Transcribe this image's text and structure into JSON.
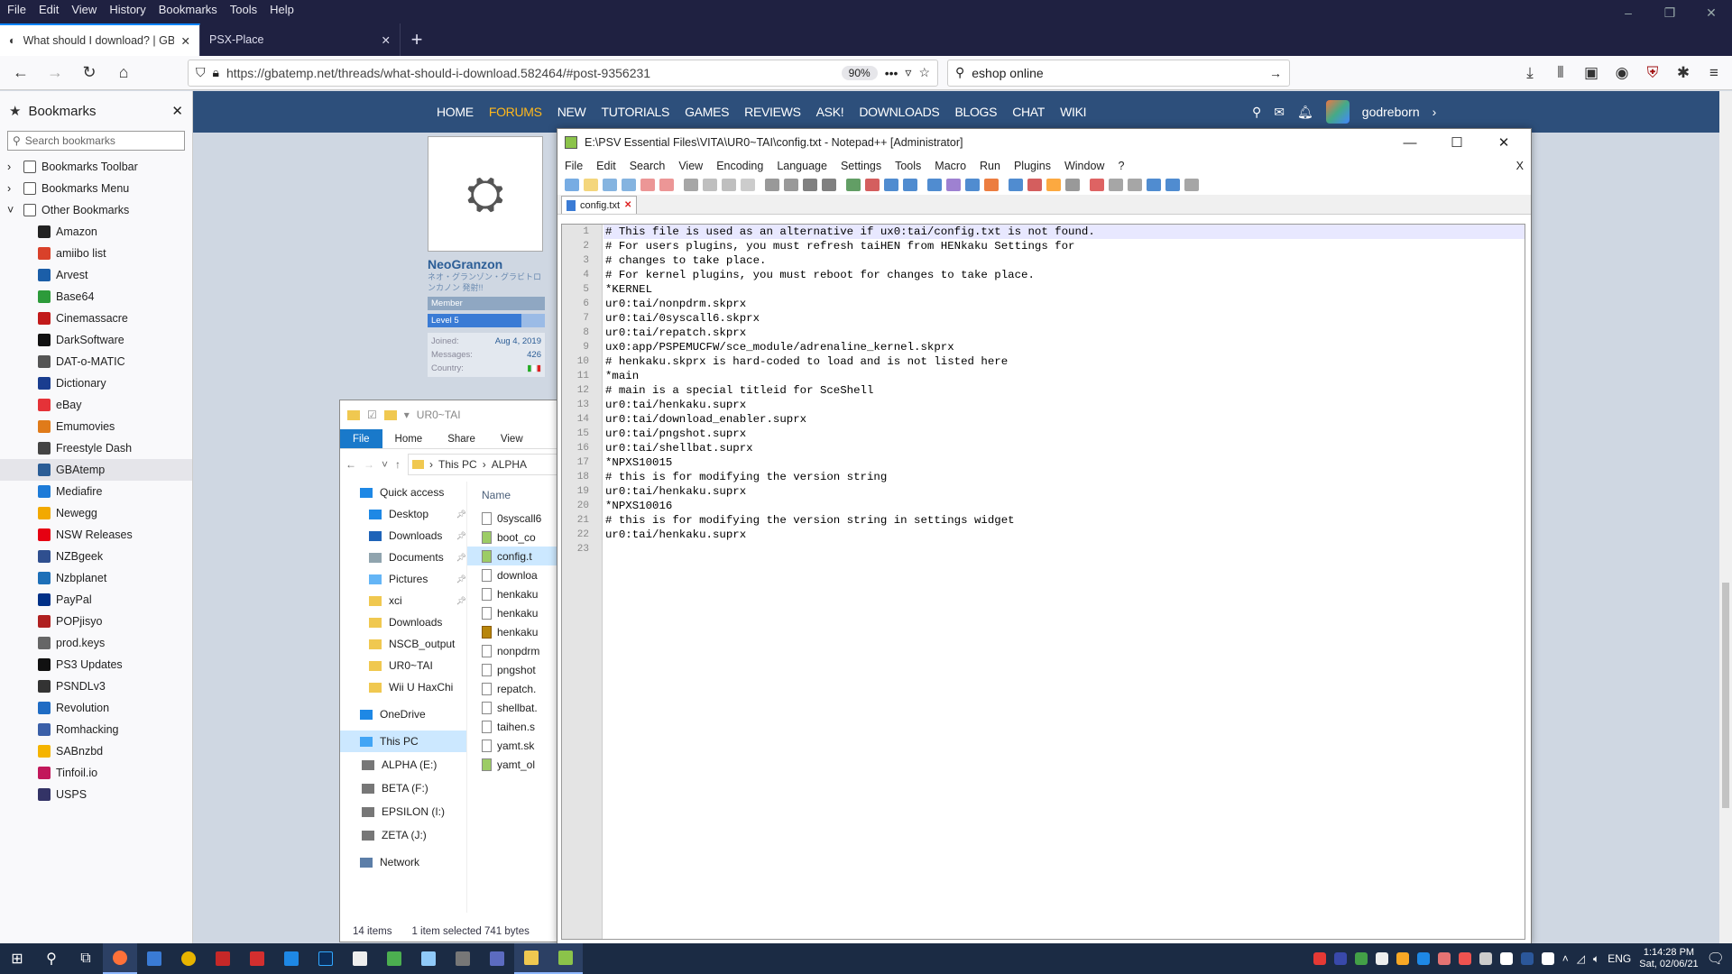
{
  "browser": {
    "menu": [
      "File",
      "Edit",
      "View",
      "History",
      "Bookmarks",
      "Tools",
      "Help"
    ],
    "tabs": [
      {
        "title": "What should I download? | GBA"
      },
      {
        "title": "PSX-Place"
      }
    ],
    "url": "https://gbatemp.net/threads/what-should-i-download.582464/#post-9356231",
    "zoom": "90%",
    "search": "eshop online"
  },
  "bookmarks": {
    "title": "Bookmarks",
    "search_placeholder": "Search bookmarks",
    "folders": [
      "Bookmarks Toolbar",
      "Bookmarks Menu",
      "Other Bookmarks"
    ],
    "items": [
      {
        "label": "Amazon",
        "color": "#222"
      },
      {
        "label": "amiibo list",
        "color": "#d9412a"
      },
      {
        "label": "Arvest",
        "color": "#1b5ea8"
      },
      {
        "label": "Base64",
        "color": "#2d9b3a"
      },
      {
        "label": "Cinemassacre",
        "color": "#c21a1a"
      },
      {
        "label": "DarkSoftware",
        "color": "#111"
      },
      {
        "label": "DAT-o-MATIC",
        "color": "#555"
      },
      {
        "label": "Dictionary",
        "color": "#1a3d8f"
      },
      {
        "label": "eBay",
        "color": "#e53238"
      },
      {
        "label": "Emumovies",
        "color": "#e07b1a"
      },
      {
        "label": "Freestyle Dash",
        "color": "#444"
      },
      {
        "label": "GBAtemp",
        "color": "#2b5d96"
      },
      {
        "label": "Mediafire",
        "color": "#1d7bd8"
      },
      {
        "label": "Newegg",
        "color": "#f2a900"
      },
      {
        "label": "NSW Releases",
        "color": "#e60012"
      },
      {
        "label": "NZBgeek",
        "color": "#2f4f8f"
      },
      {
        "label": "Nzbplanet",
        "color": "#1d6fb8"
      },
      {
        "label": "PayPal",
        "color": "#003087"
      },
      {
        "label": "POPjisyo",
        "color": "#b02020"
      },
      {
        "label": "prod.keys",
        "color": "#666"
      },
      {
        "label": "PS3 Updates",
        "color": "#111"
      },
      {
        "label": "PSNDLv3",
        "color": "#333"
      },
      {
        "label": "Revolution",
        "color": "#1f6cc4"
      },
      {
        "label": "Romhacking",
        "color": "#3a5fa8"
      },
      {
        "label": "SABnzbd",
        "color": "#f5b400"
      },
      {
        "label": "Tinfoil.io",
        "color": "#c2185b"
      },
      {
        "label": "USPS",
        "color": "#333366"
      }
    ]
  },
  "site": {
    "nav": [
      "HOME",
      "FORUMS",
      "NEW",
      "TUTORIALS",
      "GAMES",
      "REVIEWS",
      "ASK!",
      "DOWNLOADS",
      "BLOGS",
      "CHAT",
      "WIKI"
    ],
    "username": "godreborn",
    "profile": {
      "name": "NeoGranzon",
      "jp": "ネオ・グランゾン・グラビトロンカノン 発射!!",
      "badge1": "Member",
      "badge2": "Level 5",
      "joined_label": "Joined:",
      "joined": "Aug 4, 2019",
      "messages_label": "Messages:",
      "messages": "426",
      "country_label": "Country:"
    }
  },
  "explorer": {
    "title": "UR0~TAI",
    "ribbon": [
      "File",
      "Home",
      "Share",
      "View"
    ],
    "path": [
      "This PC",
      "ALPHA"
    ],
    "col_name": "Name",
    "nav": [
      {
        "label": "Quick access",
        "kind": "star"
      },
      {
        "label": "Desktop",
        "kind": "blue",
        "pin": true
      },
      {
        "label": "Downloads",
        "kind": "down",
        "pin": true
      },
      {
        "label": "Documents",
        "kind": "doc",
        "pin": true
      },
      {
        "label": "Pictures",
        "kind": "pic",
        "pin": true
      },
      {
        "label": "xci",
        "kind": "folder",
        "pin": true
      },
      {
        "label": "Downloads",
        "kind": "folder"
      },
      {
        "label": "NSCB_output",
        "kind": "folder"
      },
      {
        "label": "UR0~TAI",
        "kind": "folder"
      },
      {
        "label": "Wii U HaxChi",
        "kind": "folder"
      },
      {
        "label": "OneDrive",
        "kind": "cloud"
      },
      {
        "label": "This PC",
        "kind": "pc"
      },
      {
        "label": "ALPHA (E:)",
        "kind": "drive"
      },
      {
        "label": "BETA (F:)",
        "kind": "drive"
      },
      {
        "label": "EPSILON (I:)",
        "kind": "drive"
      },
      {
        "label": "ZETA (J:)",
        "kind": "drive"
      },
      {
        "label": "Network",
        "kind": "net"
      }
    ],
    "files": [
      "0syscall6",
      "boot_co",
      "config.t",
      "downloa",
      "henkaku",
      "henkaku",
      "henkaku",
      "nonpdrm",
      "pngshot",
      "repatch.",
      "shellbat.",
      "taihen.s",
      "yamt.sk",
      "yamt_ol"
    ],
    "status": [
      "14 items",
      "1 item selected  741 bytes"
    ]
  },
  "notepad": {
    "title": "E:\\PSV Essential Files\\VITA\\UR0~TAI\\config.txt - Notepad++ [Administrator]",
    "menu": [
      "File",
      "Edit",
      "Search",
      "View",
      "Encoding",
      "Language",
      "Settings",
      "Tools",
      "Macro",
      "Run",
      "Plugins",
      "Window",
      "?"
    ],
    "tab": "config.txt",
    "lines": [
      "# This file is used as an alternative if ux0:tai/config.txt is not found.",
      "# For users plugins, you must refresh taiHEN from HENkaku Settings for",
      "# changes to take place.",
      "# For kernel plugins, you must reboot for changes to take place.",
      "*KERNEL",
      "ur0:tai/nonpdrm.skprx",
      "ur0:tai/0syscall6.skprx",
      "ur0:tai/repatch.skprx",
      "ux0:app/PSPEMUCFW/sce_module/adrenaline_kernel.skprx",
      "# henkaku.skprx is hard-coded to load and is not listed here",
      "*main",
      "# main is a special titleid for SceShell",
      "ur0:tai/henkaku.suprx",
      "ur0:tai/download_enabler.suprx",
      "ur0:tai/pngshot.suprx",
      "ur0:tai/shellbat.suprx",
      "*NPXS10015",
      "# this is for modifying the version string",
      "ur0:tai/henkaku.suprx",
      "*NPXS10016",
      "# this is for modifying the version string in settings widget",
      "ur0:tai/henkaku.suprx",
      ""
    ]
  },
  "taskbar": {
    "lang": "ENG",
    "time": "1:14:28 PM",
    "date": "Sat, 02/06/21"
  }
}
